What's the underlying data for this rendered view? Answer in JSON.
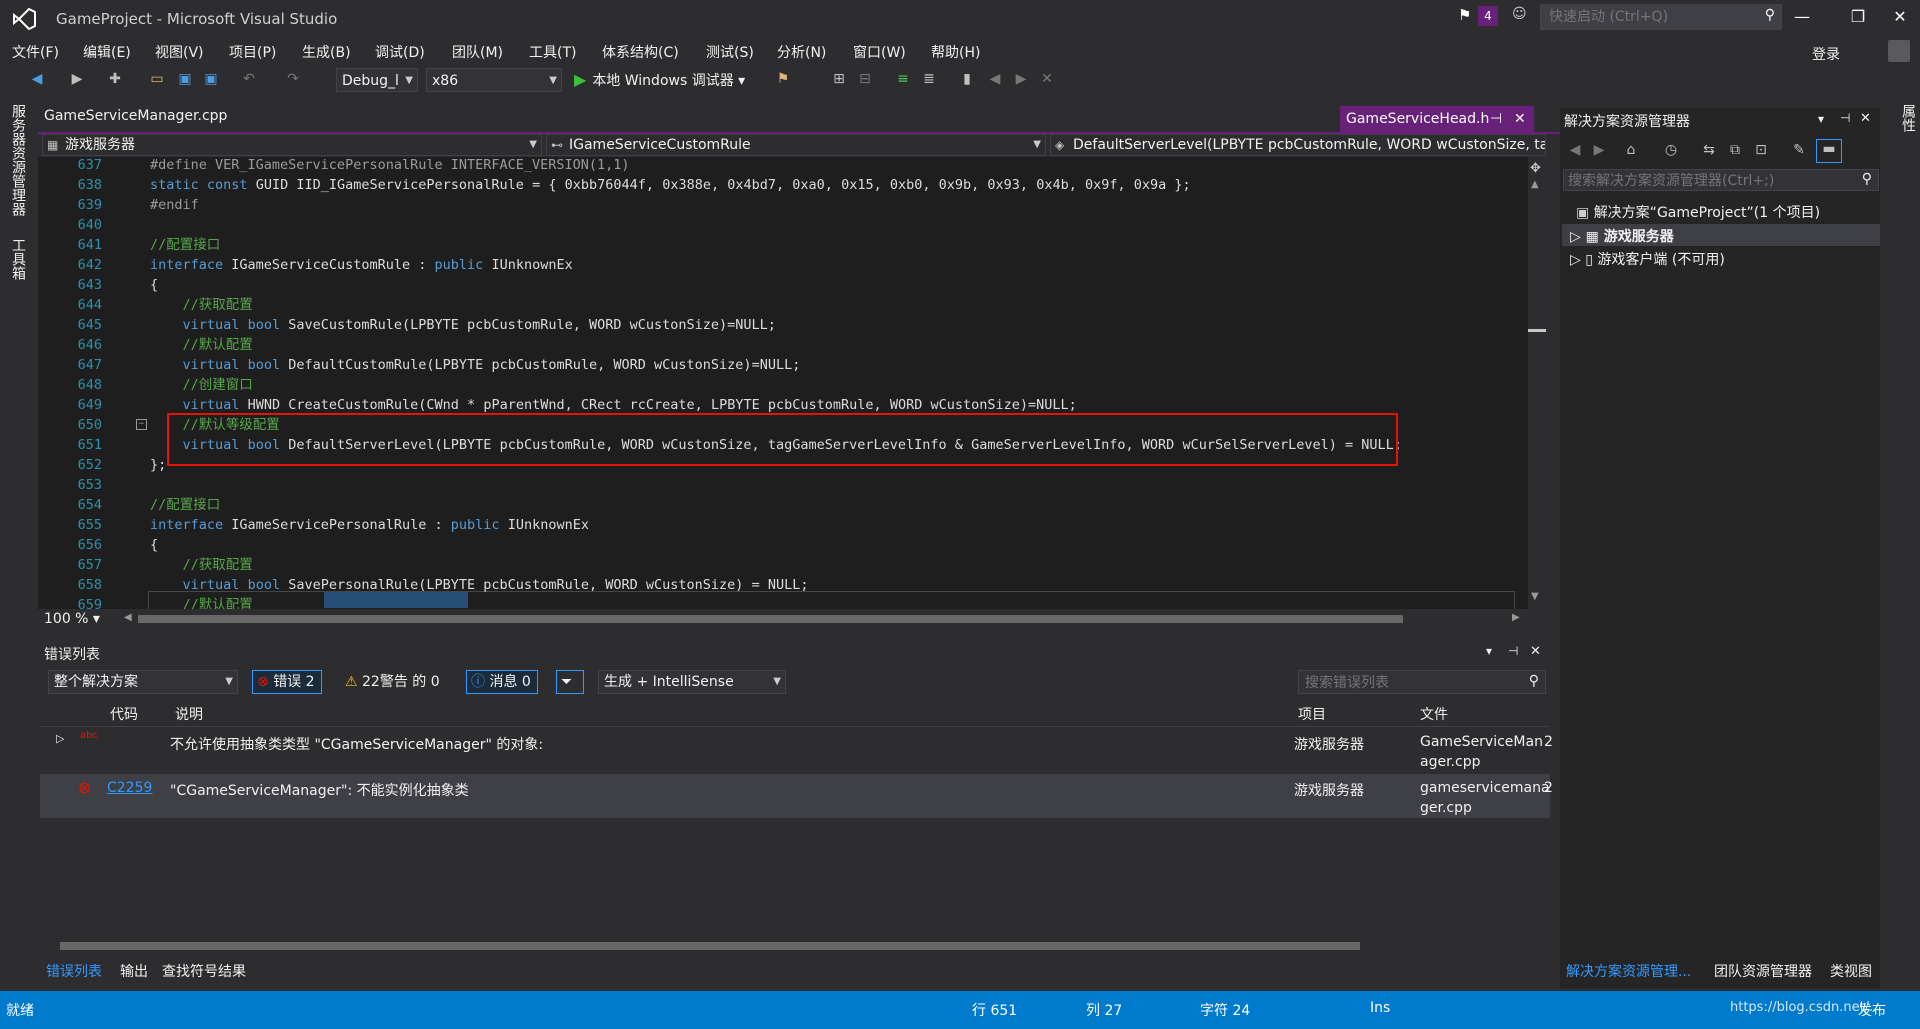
{
  "window": {
    "title": "GameProject - Microsoft Visual Studio",
    "notification_count": "4",
    "quick_launch_placeholder": "快速启动 (Ctrl+Q)"
  },
  "menu": [
    "文件(F)",
    "编辑(E)",
    "视图(V)",
    "项目(P)",
    "生成(B)",
    "调试(D)",
    "团队(M)",
    "工具(T)",
    "体系结构(C)",
    "测试(S)",
    "分析(N)",
    "窗口(W)",
    "帮助(H)"
  ],
  "account": {
    "login_label": "登录"
  },
  "toolbar": {
    "config": "Debug_l",
    "platform": "x86",
    "start_label": "本地 Windows 调试器"
  },
  "side_tabs": {
    "left": [
      "服务器资源管理器",
      "工具箱"
    ],
    "right": [
      "属性"
    ]
  },
  "editor": {
    "tabs": {
      "left": "GameServiceManager.cpp",
      "active": "GameServiceHead.h"
    },
    "nav": {
      "project": "游戏服务器",
      "scope": "IGameServiceCustomRule",
      "member": "DefaultServerLevel(LPBYTE pcbCustomRule, WORD wCustonSize, tag("
    },
    "lines": [
      {
        "n": "637",
        "t": "#define VER_IGameServicePersonalRule INTERFACE_VERSION(1,1)"
      },
      {
        "n": "638",
        "t": "static const GUID IID_IGameServicePersonalRule = { 0xbb76044f, 0x388e, 0x4bd7, 0xa0, 0x15, 0xb0, 0x9b, 0x93, 0x4b, 0x9f, 0x9a };"
      },
      {
        "n": "639",
        "t": "#endif"
      },
      {
        "n": "640",
        "t": ""
      },
      {
        "n": "641",
        "t": "//配置接口"
      },
      {
        "n": "642",
        "t": "interface IGameServiceCustomRule : public IUnknownEx"
      },
      {
        "n": "643",
        "t": "{"
      },
      {
        "n": "644",
        "t": "    //获取配置"
      },
      {
        "n": "645",
        "t": "    virtual bool SaveCustomRule(LPBYTE pcbCustomRule, WORD wCustonSize)=NULL;"
      },
      {
        "n": "646",
        "t": "    //默认配置"
      },
      {
        "n": "647",
        "t": "    virtual bool DefaultCustomRule(LPBYTE pcbCustomRule, WORD wCustonSize)=NULL;"
      },
      {
        "n": "648",
        "t": "    //创建窗口"
      },
      {
        "n": "649",
        "t": "    virtual HWND CreateCustomRule(CWnd * pParentWnd, CRect rcCreate, LPBYTE pcbCustomRule, WORD wCustonSize)=NULL;"
      },
      {
        "n": "650",
        "t": "    //默认等级配置"
      },
      {
        "n": "651",
        "t": "    virtual bool DefaultServerLevel(LPBYTE pcbCustomRule, WORD wCustonSize, tagGameServerLevelInfo & GameServerLevelInfo, WORD wCurSelServerLevel) = NULL;"
      },
      {
        "n": "652",
        "t": "};"
      },
      {
        "n": "653",
        "t": ""
      },
      {
        "n": "654",
        "t": "//配置接口"
      },
      {
        "n": "655",
        "t": "interface IGameServicePersonalRule : public IUnknownEx"
      },
      {
        "n": "656",
        "t": "{"
      },
      {
        "n": "657",
        "t": "    //获取配置"
      },
      {
        "n": "658",
        "t": "    virtual bool SavePersonalRule(LPBYTE pcbCustomRule, WORD wCustonSize) = NULL;"
      },
      {
        "n": "659",
        "t": "    //默认配置"
      }
    ],
    "zoom": "100 %"
  },
  "error_list": {
    "title": "错误列表",
    "scope": "整个解决方案",
    "errors_filter": "错误 2",
    "warnings_filter": "22警告 的 0",
    "messages_filter": "消息 0",
    "build_source": "生成 + IntelliSense",
    "search_placeholder": "搜索错误列表",
    "columns": {
      "code": "代码",
      "desc": "说明",
      "project": "项目",
      "file": "文件"
    },
    "rows": [
      {
        "code": "",
        "desc": "不允许使用抽象类类型 \"CGameServiceManager\" 的对象:",
        "project": "游戏服务器",
        "file1": "GameServiceMan",
        "file2": "ager.cpp",
        "tail": "2"
      },
      {
        "code": "C2259",
        "desc": "\"CGameServiceManager\": 不能实例化抽象类",
        "project": "游戏服务器",
        "file1": "gameservicemana",
        "file2": "ger.cpp",
        "tail": "2"
      }
    ]
  },
  "bottom_tabs": [
    "错误列表",
    "输出",
    "查找符号结果"
  ],
  "solution_explorer": {
    "title": "解决方案资源管理器",
    "search_placeholder": "搜索解决方案资源管理器(Ctrl+;)",
    "solution": "解决方案“GameProject”(1 个项目)",
    "projects": [
      "游戏服务器",
      "游戏客户端 (不可用)"
    ],
    "bottom_tabs": [
      "解决方案资源管理...",
      "团队资源管理器",
      "类视图"
    ]
  },
  "status": {
    "ready": "就绪",
    "line": "行 651",
    "col": "列 27",
    "char": "字符 24",
    "mode": "Ins",
    "publish": "发布",
    "watermark": "https://blog.csdn.net/..."
  },
  "colors": {
    "accent": "#68217a",
    "status": "#007acc",
    "redbox": "#e51400"
  }
}
